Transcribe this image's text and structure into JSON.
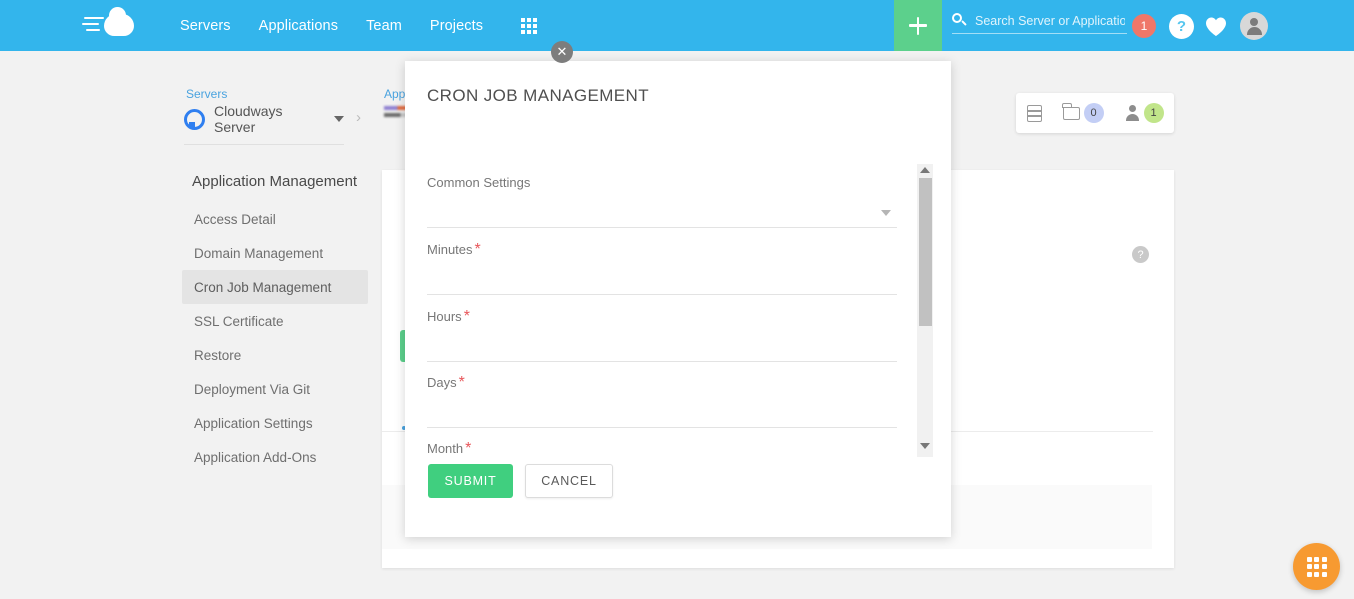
{
  "topnav": {
    "logo_name": "cloudways-logo",
    "links": [
      {
        "label": "Servers"
      },
      {
        "label": "Applications"
      },
      {
        "label": "Team"
      },
      {
        "label": "Projects"
      }
    ],
    "apps_grid_icon": "grid-icon",
    "add_button_label": "+",
    "search": {
      "placeholder": "Search Server or Application",
      "value": ""
    },
    "notification_count": "1",
    "help_label": "?",
    "heart_icon": "heart-icon",
    "avatar_icon": "user-avatar-icon",
    "bar_color": "#33b5ec",
    "add_button_color": "#5cd08c",
    "notification_color": "#ef7769"
  },
  "breadcrumb": {
    "servers_label": "Servers",
    "server_name": "Cloudways Server",
    "apps_label": "Apps",
    "separator": "›"
  },
  "stat_card": {
    "server_icon": "server-stack-icon",
    "folder_icon": "folder-icon",
    "folder_count": "0",
    "person_icon": "person-icon",
    "person_count": "1",
    "folder_badge_color": "#c3cef5",
    "person_badge_color": "#c1e58a"
  },
  "sidebar": {
    "title": "Application Management",
    "items": [
      {
        "label": "Access Detail",
        "active": false
      },
      {
        "label": "Domain Management",
        "active": false
      },
      {
        "label": "Cron Job Management",
        "active": true
      },
      {
        "label": "SSL Certificate",
        "active": false
      },
      {
        "label": "Restore",
        "active": false
      },
      {
        "label": "Deployment Via Git",
        "active": false
      },
      {
        "label": "Application Settings",
        "active": false
      },
      {
        "label": "Application Add-Ons",
        "active": false
      }
    ]
  },
  "main_panel": {
    "help_label": "?"
  },
  "modal": {
    "title": "CRON JOB MANAGEMENT",
    "close_label": "✕",
    "fields": [
      {
        "label": "Common Settings",
        "required": false,
        "type": "select",
        "value": ""
      },
      {
        "label": "Minutes",
        "required": true,
        "type": "text",
        "value": ""
      },
      {
        "label": "Hours",
        "required": true,
        "type": "text",
        "value": ""
      },
      {
        "label": "Days",
        "required": true,
        "type": "text",
        "value": ""
      },
      {
        "label": "Month",
        "required": true,
        "type": "text",
        "value": ""
      }
    ],
    "required_marker": "*",
    "submit_label": "SUBMIT",
    "cancel_label": "CANCEL",
    "submit_color": "#40cf7f"
  },
  "fab": {
    "icon": "apps-grid-icon",
    "color": "#f79a31"
  }
}
